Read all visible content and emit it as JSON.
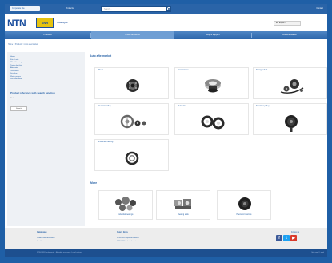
{
  "topbar": {
    "left_tab": "Corporate site",
    "link": "Products",
    "search_placeholder": "Search...",
    "right_link": "Contact"
  },
  "brand": {
    "logo": "NTN",
    "partner_logo": "SNR",
    "tagline": "Catalogue"
  },
  "language": {
    "selected": "EN English"
  },
  "nav": {
    "tabs": [
      "Products",
      "Cross-reference",
      "Help & support",
      "Documentation"
    ],
    "active_index": 1
  },
  "breadcrumb": "Home > Products > Auto aftermarket",
  "sidebar": {
    "items": [
      "Home",
      "Kits & sets",
      "Wheel bearings",
      "Timing belt kits",
      "Alternator",
      "Tensioners",
      "Driveline",
      "Water pumps",
      "Documentation"
    ],
    "title": "Product reference with search function",
    "subtitle": "Reference",
    "button": "Search"
  },
  "main": {
    "section1_title": "Auto aftermarket",
    "categories": [
      {
        "label": "Wheel",
        "icon": "wheel-bearing"
      },
      {
        "label": "Transmission",
        "icon": "transmission-bearing"
      },
      {
        "label": "Timing belt kit",
        "icon": "timing-belt-kit"
      },
      {
        "label": "Alternator pulley",
        "icon": "alternator-pulley"
      },
      {
        "label": "Clutch kit",
        "icon": "clutch-kit"
      },
      {
        "label": "Tensioner pulley",
        "icon": "tensioner-pulley"
      },
      {
        "label": "Drive shaft bearing",
        "icon": "drive-shaft-bearing"
      }
    ],
    "section2_title": "More",
    "more": [
      {
        "caption": "Industrial bearings",
        "icon": "industrial-bearings"
      },
      {
        "caption": "Bearing units",
        "icon": "bearing-units"
      },
      {
        "caption": "Precision bearings",
        "icon": "precision-bearings"
      }
    ]
  },
  "footer": {
    "col1_title": "Catalogue",
    "col1_links": [
      "Product documentation",
      "Conditions"
    ],
    "col2_title": "Quick links",
    "col2_links": [
      "NTN-SNR corporate website",
      "NTN-SNR technical center"
    ],
    "follow": "Follow us",
    "social": [
      "facebook-icon",
      "twitter-icon",
      "youtube-icon"
    ],
    "social_colors": [
      "#3b5998",
      "#1da1f2",
      "#d93a2b"
    ],
    "copyright": "NTN-SNR Roulements - All rights reserved - Legal notices",
    "right": "Site map | Legal"
  },
  "colors": {
    "frame": "#1f5fa6",
    "accent": "#2a64a8",
    "nav": "#4f86c4"
  }
}
